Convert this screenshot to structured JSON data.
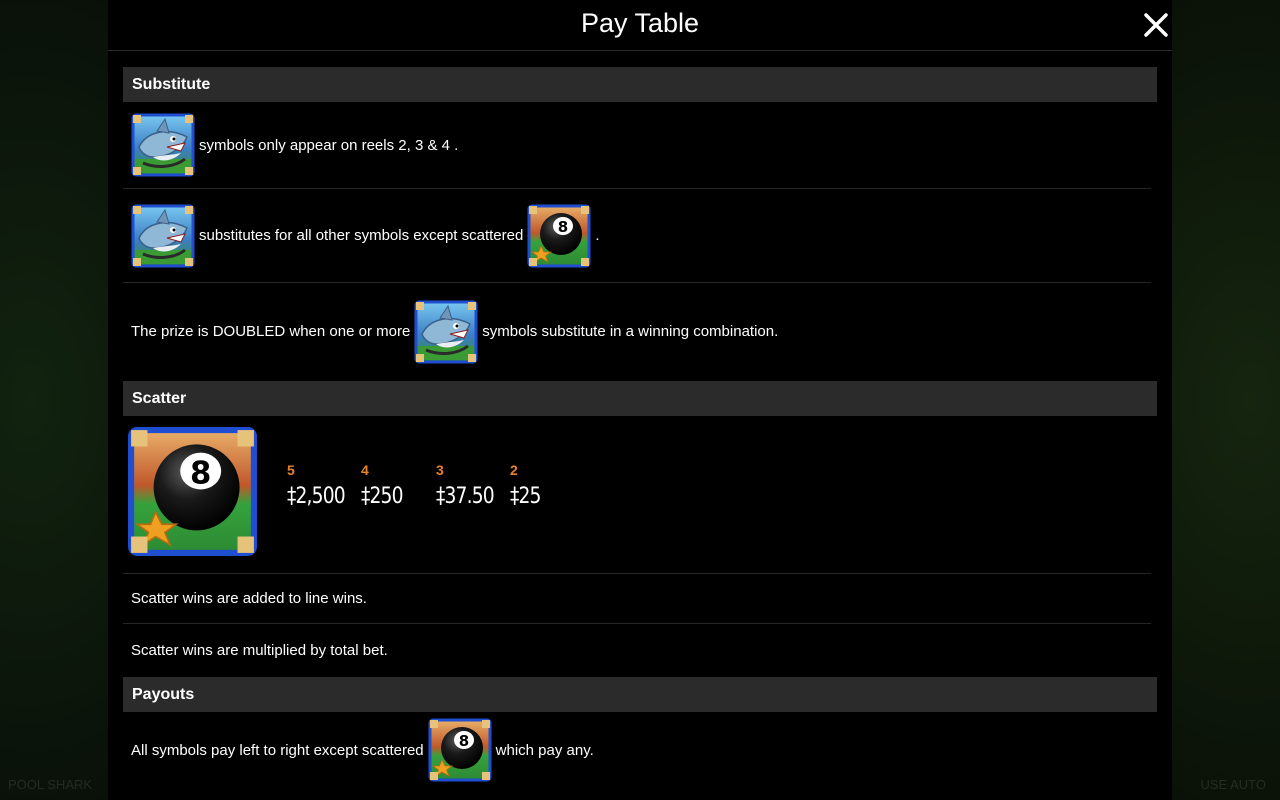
{
  "window": {
    "title": "Pay Table",
    "close_icon": "close-icon"
  },
  "background": {
    "left_corner_text": "POOL SHARK",
    "right_corner_text": "USE AUTO"
  },
  "colors": {
    "section_header_bg": "#2b2b2b",
    "payout_count": "#e8832b",
    "panel_bg": "#000000"
  },
  "substitute": {
    "heading": "Substitute",
    "line1": {
      "text": "symbols only appear on reels 2, 3 & 4 ."
    },
    "line2": {
      "text_before": "substitutes for all other symbols except scattered",
      "text_after": "."
    },
    "line3": {
      "text_before": "The prize is DOUBLED when one or more",
      "text_after": "symbols substitute in a winning combination."
    }
  },
  "scatter": {
    "heading": "Scatter",
    "payouts": [
      {
        "count": "5",
        "value": "‡2,500"
      },
      {
        "count": "4",
        "value": "‡250"
      },
      {
        "count": "3",
        "value": "‡37.50"
      },
      {
        "count": "2",
        "value": "‡25"
      }
    ],
    "note1": "Scatter wins are added to line wins.",
    "note2": "Scatter wins are multiplied by total bet."
  },
  "payouts": {
    "heading": "Payouts",
    "line1": {
      "text_before": "All symbols pay left to right except scattered",
      "text_after": "which pay any."
    }
  },
  "symbols": {
    "wild": "shark-wild-symbol-icon",
    "scatter": "eight-ball-scatter-symbol-icon"
  }
}
